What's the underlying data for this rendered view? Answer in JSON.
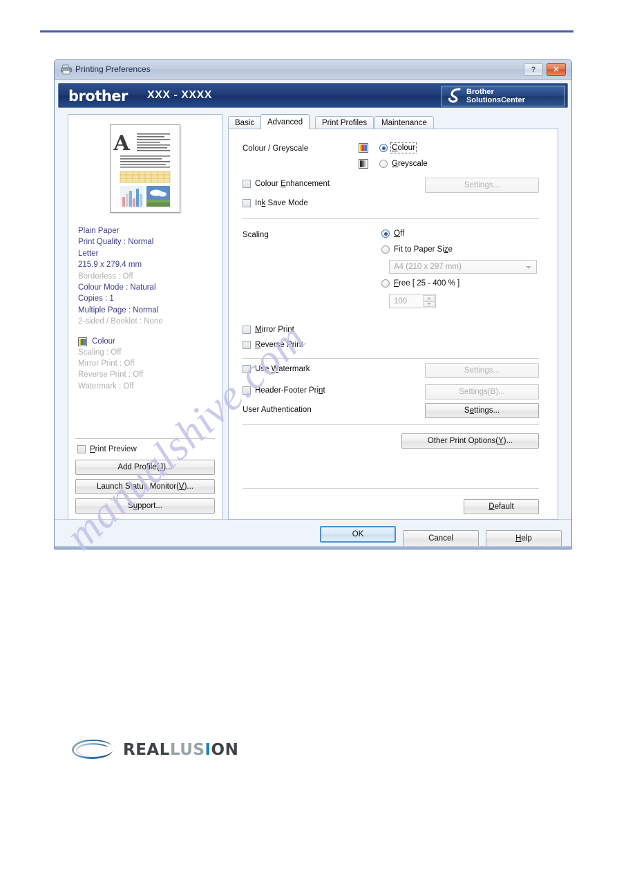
{
  "window": {
    "title": "Printing Preferences",
    "title_icon": "printer-icon",
    "help_button": "?",
    "close_button": "✕"
  },
  "banner": {
    "brand": "brother",
    "model": "XXX - XXXX",
    "solutions_center_line1": "Brother",
    "solutions_center_line2": "SolutionsCenter",
    "logo_icon": "brother-hook-icon"
  },
  "left_pane": {
    "preview_icon": "page-preview-thumbnail",
    "settings": [
      {
        "text": "Plain Paper",
        "enabled": true
      },
      {
        "text": "Print Quality : Normal",
        "enabled": true
      },
      {
        "text": "Letter",
        "enabled": true
      },
      {
        "text": "215.9 x 279.4 mm",
        "enabled": true
      },
      {
        "text": "Borderless : Off",
        "enabled": false
      },
      {
        "text": "Colour Mode : Natural",
        "enabled": true
      },
      {
        "text": "Copies : 1",
        "enabled": true
      },
      {
        "text": "Multiple Page : Normal",
        "enabled": true
      },
      {
        "text": "2-sided / Booklet : None",
        "enabled": false
      }
    ],
    "colour_label": "Colour",
    "colour_sub": [
      "Scaling : Off",
      "Mirror Print : Off",
      "Reverse Print : Off",
      "Watermark : Off"
    ],
    "print_preview_label": "Print Preview",
    "print_preview_checked": false,
    "buttons": [
      {
        "label": "Add Profile(J)...",
        "accel": "J"
      },
      {
        "label": "Launch Status Monitor(V)...",
        "accel": "V"
      },
      {
        "label": "Support...",
        "accel": "u"
      }
    ]
  },
  "tabs": [
    {
      "label": "Basic",
      "active": false
    },
    {
      "label": "Advanced",
      "active": true
    },
    {
      "label": "Print Profiles",
      "active": false
    },
    {
      "label": "Maintenance",
      "active": false
    }
  ],
  "advanced": {
    "colour_greyscale_label": "Colour / Greyscale",
    "colour_option": "Colour",
    "greyscale_option": "Greyscale",
    "colour_selected": true,
    "colour_swatch_icon": "colour-bars-icon",
    "greyscale_swatch_icon": "greyscale-gradient-icon",
    "colour_enhancement_label": "Colour Enhancement",
    "colour_enhancement_checked": false,
    "colour_enhancement_settings": "Settings...",
    "ink_save_label": "Ink Save Mode",
    "ink_save_checked": false,
    "scaling_label": "Scaling",
    "scaling_off": "Off",
    "scaling_fit": "Fit to Paper Size",
    "scaling_free": "Free [ 25 - 400 % ]",
    "scaling_selected": "Off",
    "paper_size_value": "A4 (210 x 297 mm)",
    "free_value": "100",
    "mirror_print_label": "Mirror Print",
    "mirror_print_checked": false,
    "reverse_print_label": "Reverse Print",
    "reverse_print_checked": false,
    "use_watermark_label": "Use Watermark",
    "use_watermark_checked": false,
    "watermark_settings": "Settings...",
    "header_footer_label": "Header-Footer Print",
    "header_footer_checked": false,
    "header_footer_settings": "Settings(B)...",
    "user_auth_label": "User Authentication",
    "user_auth_settings": "Settings...",
    "other_print_options": "Other Print Options(Y)...",
    "default_button": "Default"
  },
  "footer": {
    "ok": "OK",
    "cancel": "Cancel",
    "help": "Help"
  },
  "page": {
    "watermark_text": "manualshive.com",
    "reallusion_part1": "REAL",
    "reallusion_part2": "LUS",
    "reallusion_part3": "I",
    "reallusion_part4": "ON",
    "reallusion_icon": "reallusion-swoosh-icon"
  },
  "colors": {
    "rule": "#4a5aa8",
    "banner": "#1d3a74",
    "active_setting": "#3c3c8c",
    "disabled_setting": "#b0b0b0",
    "close_button": "#d4532a",
    "default_button_border": "#4f8fd0"
  }
}
